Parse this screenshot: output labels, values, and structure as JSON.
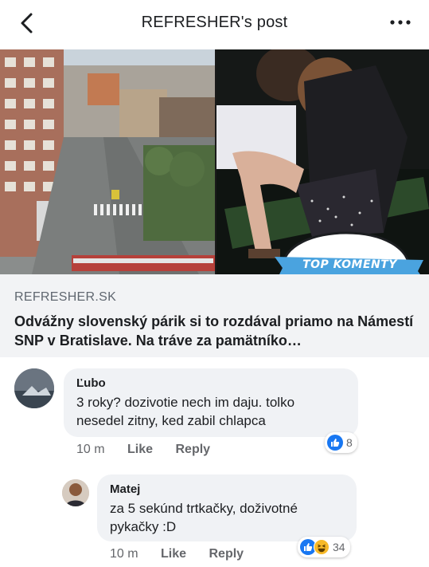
{
  "header": {
    "title": "REFRESHER's post"
  },
  "preview": {
    "badge": "TOP KOMENTY",
    "domain": "REFRESHER.SK",
    "title": "Odvážny slovenský párik si to rozdával priamo na Námestí SNP v Bratislave. Na tráve za pamätníko…"
  },
  "comments": [
    {
      "author": "Ľubo",
      "text": "3 roky? dozivotie nech im daju. tolko nesedel zitny, ked zabil chlapca",
      "time": "10 m",
      "like_label": "Like",
      "reply_label": "Reply",
      "reaction_count": "8",
      "reactions": [
        "like"
      ]
    },
    {
      "author": "Matej",
      "text": "za 5 sekúnd trtkačky, doživotné pykačky :D",
      "time": "10 m",
      "like_label": "Like",
      "reply_label": "Reply",
      "reaction_count": "34",
      "reactions": [
        "like",
        "haha"
      ]
    }
  ],
  "colors": {
    "like_blue": "#1877f2",
    "haha_yellow": "#f7b928",
    "badge_blue": "#4aa3df"
  }
}
